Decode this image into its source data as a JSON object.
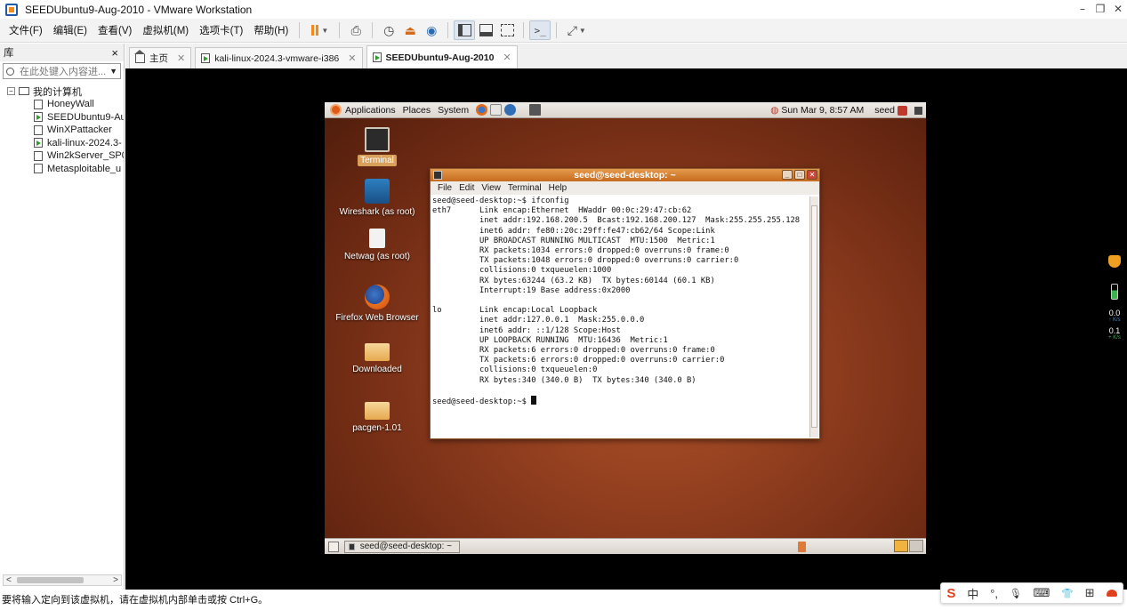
{
  "window": {
    "title": "SEEDUbuntu9-Aug-2010 - VMware Workstation",
    "minimize": "–",
    "restore": "❐",
    "close": "✕"
  },
  "menus": [
    "文件(F)",
    "编辑(E)",
    "查看(V)",
    "虚拟机(M)",
    "选项卡(T)",
    "帮助(H)"
  ],
  "library": {
    "title": "库",
    "close": "×",
    "search_placeholder": "在此处键入内容进...",
    "root": "我的计算机",
    "items": [
      {
        "label": "HoneyWall",
        "running": false
      },
      {
        "label": "SEEDUbuntu9-Au",
        "running": true
      },
      {
        "label": "WinXPattacker",
        "running": false
      },
      {
        "label": "kali-linux-2024.3-",
        "running": true
      },
      {
        "label": "Win2kServer_SP0",
        "running": false
      },
      {
        "label": "Metasploitable_u",
        "running": false
      }
    ]
  },
  "tabs": [
    {
      "label": "主页",
      "active": false
    },
    {
      "label": "kali-linux-2024.3-vmware-i386",
      "active": false
    },
    {
      "label": "SEEDUbuntu9-Aug-2010",
      "active": true
    }
  ],
  "guest": {
    "top_panel": {
      "menus": [
        "Applications",
        "Places",
        "System"
      ],
      "clock": "Sun Mar  9,  8:57 AM",
      "user": "seed"
    },
    "desktop_icons": [
      {
        "label": "Terminal",
        "icon": "terminal-icon",
        "selected": true
      },
      {
        "label": "Wireshark (as root)",
        "icon": "wireshark-icon",
        "selected": false
      },
      {
        "label": "Netwag (as root)",
        "icon": "netwag-icon",
        "selected": false
      },
      {
        "label": "Firefox Web Browser",
        "icon": "firefox-icon",
        "selected": false
      },
      {
        "label": "Downloaded",
        "icon": "folder-icon",
        "selected": false
      },
      {
        "label": "pacgen-1.01",
        "icon": "folder-icon",
        "selected": false
      }
    ],
    "terminal": {
      "title": "seed@seed-desktop: ~",
      "menu": [
        "File",
        "Edit",
        "View",
        "Terminal",
        "Help"
      ],
      "lines": [
        "seed@seed-desktop:~$ ifconfig",
        "eth7      Link encap:Ethernet  HWaddr 00:0c:29:47:cb:62",
        "          inet addr:192.168.200.5  Bcast:192.168.200.127  Mask:255.255.255.128",
        "          inet6 addr: fe80::20c:29ff:fe47:cb62/64 Scope:Link",
        "          UP BROADCAST RUNNING MULTICAST  MTU:1500  Metric:1",
        "          RX packets:1034 errors:0 dropped:0 overruns:0 frame:0",
        "          TX packets:1048 errors:0 dropped:0 overruns:0 carrier:0",
        "          collisions:0 txqueuelen:1000",
        "          RX bytes:63244 (63.2 KB)  TX bytes:60144 (60.1 KB)",
        "          Interrupt:19 Base address:0x2000",
        "",
        "lo        Link encap:Local Loopback",
        "          inet addr:127.0.0.1  Mask:255.0.0.0",
        "          inet6 addr: ::1/128 Scope:Host",
        "          UP LOOPBACK RUNNING  MTU:16436  Metric:1",
        "          RX packets:6 errors:0 dropped:0 overruns:0 frame:0",
        "          TX packets:6 errors:0 dropped:0 overruns:0 carrier:0",
        "          collisions:0 txqueuelen:0",
        "          RX bytes:340 (340.0 B)  TX bytes:340 (340.0 B)",
        ""
      ],
      "prompt": "seed@seed-desktop:~$ "
    },
    "taskbar": {
      "window_button": "seed@seed-desktop: ~"
    }
  },
  "net_widget": {
    "down": "0.0",
    "down_unit": "K/s",
    "up": "0.1",
    "up_unit": "K/s"
  },
  "statusbar": {
    "text": "要将输入定向到该虚拟机，请在虚拟机内部单击或按 Ctrl+G。"
  },
  "ime": {
    "logo": "S",
    "mode": "中",
    "punct": "°,",
    "mic": "🎙",
    "keyboard": "⌨",
    "skin": "👕",
    "grid": "⊞"
  },
  "colors": {
    "accent_orange": "#f08a1c",
    "gnome_title": "#d97b2c",
    "desktop_brown": "#8c3b1d"
  }
}
